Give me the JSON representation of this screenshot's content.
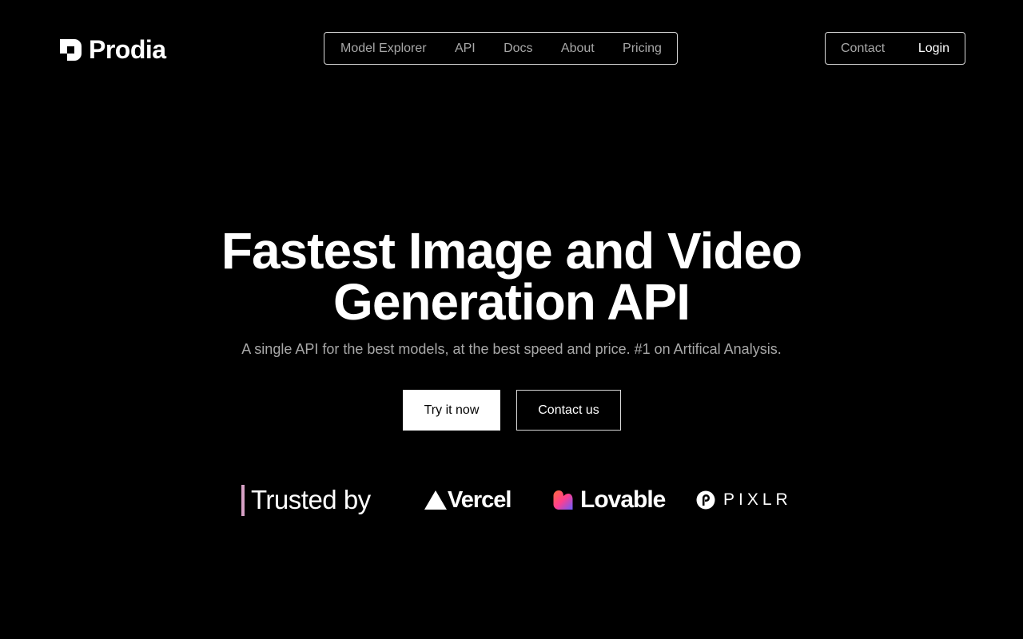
{
  "header": {
    "logo_text": "Prodia",
    "nav": [
      {
        "label": "Model Explorer"
      },
      {
        "label": "API"
      },
      {
        "label": "Docs"
      },
      {
        "label": "About"
      },
      {
        "label": "Pricing"
      }
    ],
    "contact_label": "Contact",
    "login_label": "Login"
  },
  "hero": {
    "title_line1": "Fastest Image and Video",
    "title_line2": "Generation API",
    "subtitle": "A single API for the best models, at the best speed and price. #1 on Artifical Analysis.",
    "primary_cta": "Try it now",
    "secondary_cta": "Contact us"
  },
  "trusted": {
    "label": "Trusted by",
    "brands": [
      {
        "name": "Vercel",
        "icon": "vercel-triangle-icon"
      },
      {
        "name": "Lovable",
        "icon": "lovable-heart-icon"
      },
      {
        "name": "PIXLR",
        "icon": "pixlr-icon"
      }
    ]
  },
  "colors": {
    "background": "#000000",
    "text_primary": "#ffffff",
    "text_muted": "#a8a8a8",
    "border": "#d9d9d9",
    "accent_bar": "#d8a2c6"
  }
}
